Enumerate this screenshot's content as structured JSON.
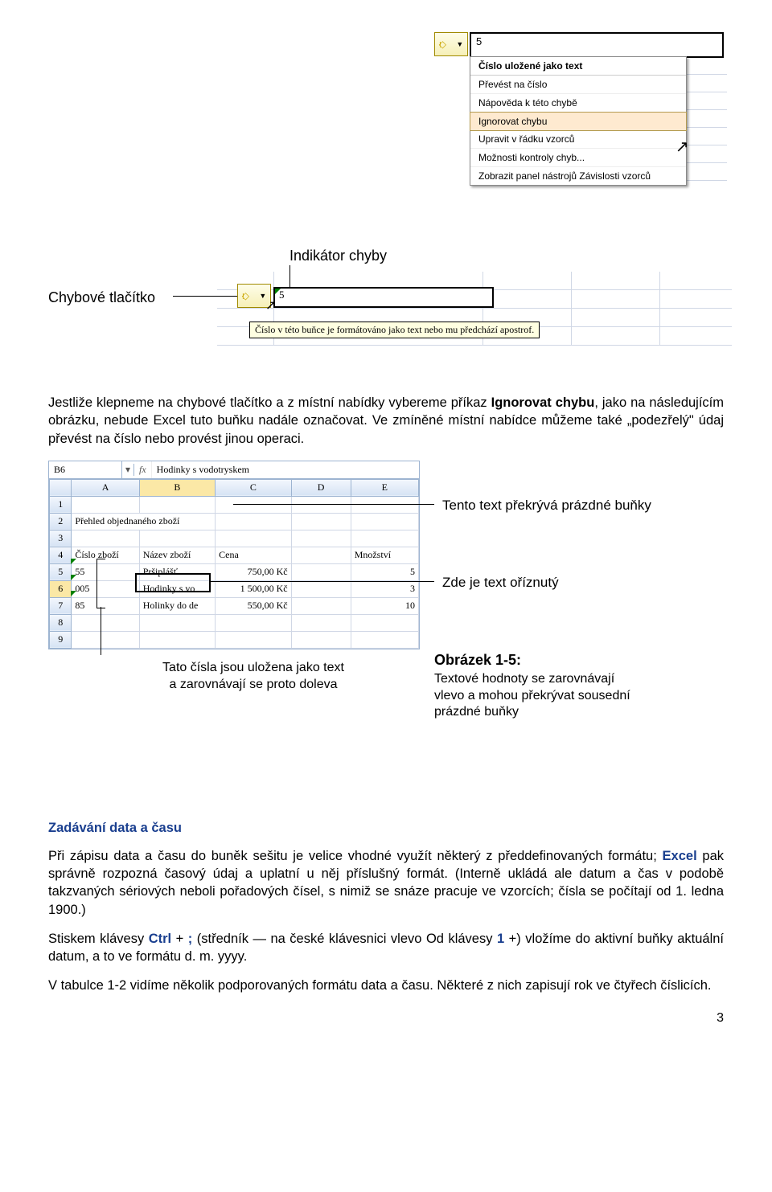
{
  "fig1": {
    "cell_value": "5",
    "menu": {
      "header": "Číslo uložené jako text",
      "items": [
        "Převést na číslo",
        "Nápověda k této chybě",
        "Ignorovat chybu",
        "Upravit v řádku vzorců",
        "Možnosti kontroly chyb...",
        "Zobrazit panel nástrojů Závislosti vzorců"
      ],
      "highlight_index": 2
    }
  },
  "fig2": {
    "label_button": "Chybové tlačítko",
    "label_indicator": "Indikátor chyby",
    "cell_value": "5",
    "tooltip": "Číslo v této buňce je formátováno jako text nebo mu předchází apostrof."
  },
  "para1": "Jestliže klepneme na chybové tlačítko a z místní nabídky vybereme příkaz ",
  "para1_bold": "Ignorovat chybu",
  "para1_cont": ", jako na následujícím obrázku, nebude Excel tuto buňku nadále označovat. Ve zmíněné místní nabídce můžeme také „podezřelý\" údaj převést na číslo nebo provést jinou operaci.",
  "fig3": {
    "namebox": "B6",
    "fx_label": "fx",
    "formula_value": "Hodinky s vodotryskem",
    "cols": [
      "A",
      "B",
      "C",
      "D",
      "E"
    ],
    "rows": [
      {
        "n": "1",
        "cells": [
          "",
          "",
          "",
          "",
          ""
        ]
      },
      {
        "n": "2",
        "cells": [
          "Přehled objednaného zboží",
          "",
          "",
          "",
          ""
        ]
      },
      {
        "n": "3",
        "cells": [
          "",
          "",
          "",
          "",
          ""
        ]
      },
      {
        "n": "4",
        "cells": [
          "Číslo zboží",
          "Název zboží",
          "Cena",
          "",
          "Množství"
        ]
      },
      {
        "n": "5",
        "cells": [
          "55",
          "Pršiplášť",
          "750,00 Kč",
          "",
          "5"
        ]
      },
      {
        "n": "6",
        "cells": [
          "005",
          "Hodinky s vo",
          "1 500,00 Kč",
          "",
          "3"
        ]
      },
      {
        "n": "7",
        "cells": [
          "85",
          "Holinky do de",
          "550,00 Kč",
          "",
          "10"
        ]
      },
      {
        "n": "8",
        "cells": [
          "",
          "",
          "",
          "",
          ""
        ]
      },
      {
        "n": "9",
        "cells": [
          "",
          "",
          "",
          "",
          ""
        ]
      }
    ],
    "ann_right1": "Tento text překrývá prázdné buňky",
    "ann_right2": "Zde je text oříznutý",
    "ann_bottom_left_l1": "Tato čísla jsou uložena jako text",
    "ann_bottom_left_l2": "a zarovnávají se proto doleva",
    "fig_label": "Obrázek 1-5:",
    "fig_caption_l1": "Textové hodnoty se zarovnávají",
    "fig_caption_l2": "vlevo a mohou překrývat sousední",
    "fig_caption_l3": "prázdné buňky"
  },
  "heading2": "Zadávání data a času",
  "para2a": "Při zápisu data a času do buněk sešitu je velice vhodné využít některý z předdefinovaných formátu; ",
  "para2_excel": "Excel",
  "para2b": " pak správně rozpozná časový údaj a uplatní u něj příslušný formát. (Interně ukládá ale datum a čas v podobě takzvaných sériových neboli pořadových čísel, s nimiž se snáze pracuje ve vzorcích; čísla se počítají od 1. ledna 1900.)",
  "para3a": "Stiskem klávesy ",
  "para3_ctrl": "Ctrl",
  "para3b": " + ",
  "para3_semi": ";",
  "para3c": " (středník — na české klávesnici vlevo Od klávesy ",
  "para3_one": "1",
  "para3d": " +) vložíme do aktivní buňky aktuální datum, a to ve formátu d. m. yyyy.",
  "para4": "V tabulce 1-2 vidíme několik podporovaných formátu data a času. Některé z nich zapisují rok ve čtyřech číslicích.",
  "pagenum": "3"
}
